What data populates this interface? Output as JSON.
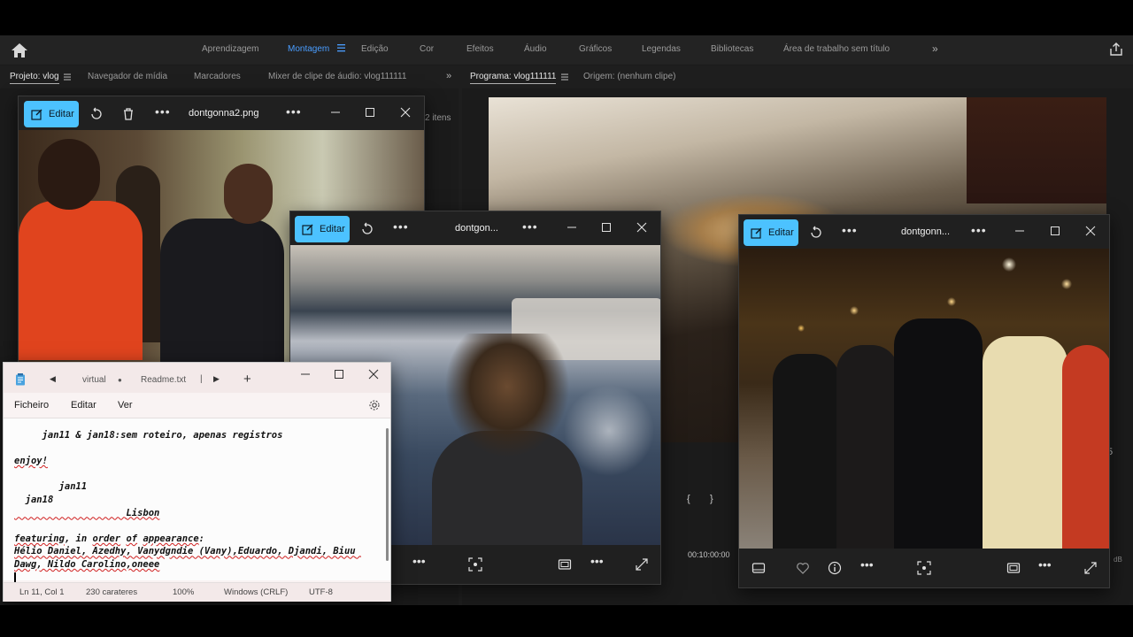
{
  "premiere": {
    "workspaces": [
      {
        "label": "Aprendizagem",
        "active": false
      },
      {
        "label": "Montagem",
        "active": true
      },
      {
        "label": "Edição",
        "active": false
      },
      {
        "label": "Cor",
        "active": false
      },
      {
        "label": "Efeitos",
        "active": false
      },
      {
        "label": "Áudio",
        "active": false
      },
      {
        "label": "Gráficos",
        "active": false
      },
      {
        "label": "Legendas",
        "active": false
      },
      {
        "label": "Bibliotecas",
        "active": false
      },
      {
        "label": "Área de trabalho sem título",
        "active": false
      }
    ],
    "more_symbol": "»",
    "left_tabs": [
      "Projeto: vlog",
      "Navegador de mídia",
      "Marcadores",
      "Mixer de clipe de áudio: vlog111111"
    ],
    "left_chevron": "»",
    "items_count": "2 itens",
    "right_tabs": [
      "Programa: vlog111111",
      "Origem: (nenhum clipe)"
    ],
    "timecode": "00:10:00:00",
    "bracket_left": "{",
    "bracket_right": "}",
    "level_number": "5",
    "db_label": "dB",
    "accent_color": "#4a9dff"
  },
  "photos_windows": [
    {
      "edit_label": "Editar",
      "title": "dontgonna2.png"
    },
    {
      "edit_label": "Editar",
      "title": "dontgon..."
    },
    {
      "edit_label": "Editar",
      "title": "dontgonn..."
    }
  ],
  "photos_accent": "#4cc2ff",
  "notepad": {
    "tabs": [
      "virtual",
      "Readme.txt"
    ],
    "tab_modified_dot": "●",
    "tab_separator": "|",
    "new_tab": "+",
    "menu": [
      "Ficheiro",
      "Editar",
      "Ver"
    ],
    "lines": {
      "l1": "     jan11 & jan18:sem roteiro, apenas registros",
      "l3": "enjoy!",
      "l5": "        jan11",
      "l6": "  jan18",
      "l7": "                    Lisbon",
      "l9a": "featuring",
      "l9b": ", in ",
      "l9c": "order",
      "l9d": " ",
      "l9e": "of",
      "l9f": " ",
      "l9g": "appearance",
      "l9h": ":",
      "l10": "Hélio Daniel, Azedhy, Vanydgndie (Vany),Eduardo, Djandi, Biuu Dawg, Nildo Carolino,oneee"
    },
    "status": {
      "position": "Ln 11, Col 1",
      "chars": "230 carateres",
      "zoom": "100%",
      "line_ending": "Windows (CRLF)",
      "encoding": "UTF-8"
    }
  }
}
